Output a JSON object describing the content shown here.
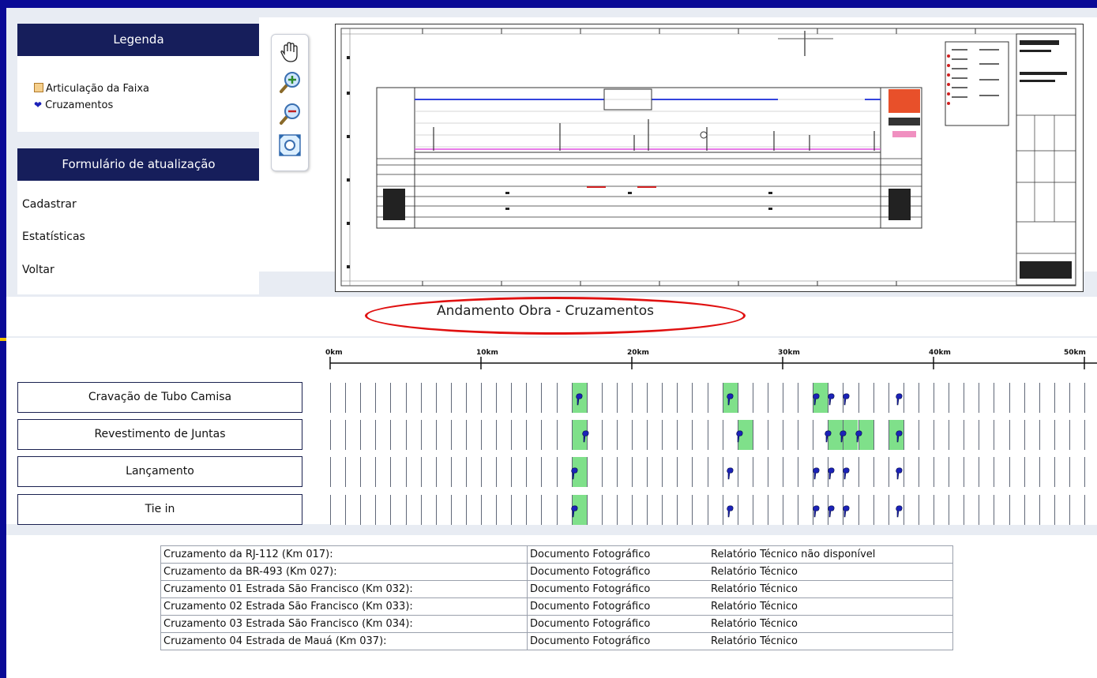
{
  "sidebar": {
    "legend_title": "Legenda",
    "legend_items": [
      "Articulação da Faixa",
      "Cruzamentos"
    ],
    "form_title": "Formulário de atualização",
    "links": [
      "Cadastrar",
      "Estatísticas",
      "Voltar"
    ]
  },
  "map_tools": [
    "pan-hand-icon",
    "zoom-in-icon",
    "zoom-out-icon",
    "zoom-extent-icon"
  ],
  "title": "Andamento Obra - Cruzamentos",
  "scale": {
    "labels": [
      "0km",
      "10km",
      "20km",
      "30km",
      "40km",
      "50km"
    ],
    "max_km": 50
  },
  "rows": [
    {
      "label": "Cravação de Tubo Camisa",
      "pins_km": [
        16.5,
        26.5,
        32.2,
        33.2,
        34.2,
        37.7
      ],
      "done_km": [
        16.5,
        26.5,
        32.2
      ]
    },
    {
      "label": "Revestimento de Juntas",
      "pins_km": [
        16.9,
        27.1,
        33.0,
        34.0,
        35.0,
        37.7
      ],
      "done_km": [
        16.9,
        27.1,
        33.0,
        34.0,
        35.0,
        37.7
      ]
    },
    {
      "label": "Lançamento",
      "pins_km": [
        16.2,
        26.5,
        32.2,
        33.2,
        34.2,
        37.7
      ],
      "done_km": [
        16.2
      ]
    },
    {
      "label": "Tie in",
      "pins_km": [
        16.2,
        26.5,
        32.2,
        33.2,
        34.2,
        37.7
      ],
      "done_km": [
        16.2
      ]
    }
  ],
  "crossings": [
    {
      "name": "Cruzamento da RJ-112 (Km 017):",
      "photo": "Documento Fotográfico",
      "report": "Relatório Técnico não disponível"
    },
    {
      "name": "Cruzamento da BR-493 (Km 027):",
      "photo": "Documento Fotográfico",
      "report": "Relatório Técnico"
    },
    {
      "name": "Cruzamento 01 Estrada São Francisco (Km 032):",
      "photo": "Documento Fotográfico",
      "report": "Relatório Técnico"
    },
    {
      "name": "Cruzamento 02 Estrada São Francisco (Km 033):",
      "photo": "Documento Fotográfico",
      "report": "Relatório Técnico"
    },
    {
      "name": "Cruzamento 03 Estrada São Francisco (Km 034):",
      "photo": "Documento Fotográfico",
      "report": "Relatório Técnico"
    },
    {
      "name": "Cruzamento 04 Estrada de Mauá (Km 037):",
      "photo": "Documento Fotográfico",
      "report": "Relatório Técnico"
    }
  ],
  "colors": {
    "frame": "#0a0a96",
    "header": "#161e5b",
    "done_cell": "#7fe08a",
    "pin": "#1c22b8",
    "highlight_oval": "#e01010"
  }
}
